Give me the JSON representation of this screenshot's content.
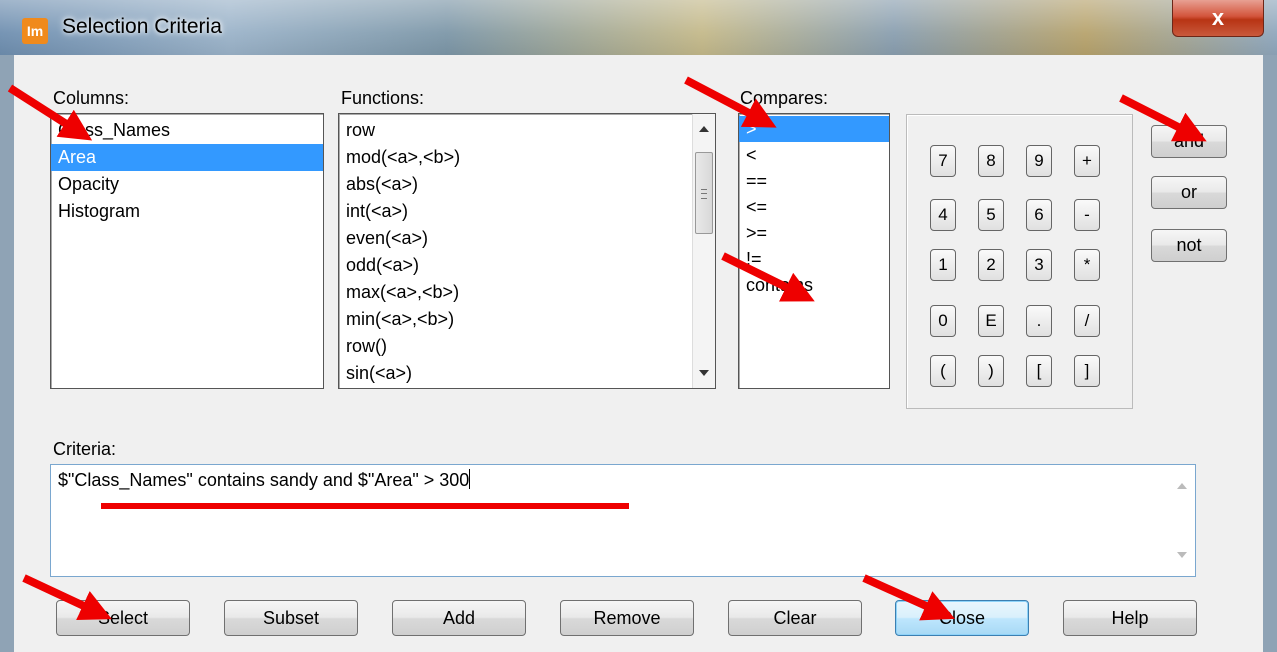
{
  "window": {
    "title": "Selection Criteria",
    "app_icon": "Im",
    "close_glyph": "x"
  },
  "columns": {
    "label": "Columns:",
    "items": [
      "Class_Names",
      "Area",
      "Opacity",
      "Histogram"
    ],
    "selected": "Area"
  },
  "functions": {
    "label": "Functions:",
    "items": [
      "row",
      "mod(<a>,<b>)",
      "abs(<a>)",
      "int(<a>)",
      "even(<a>)",
      "odd(<a>)",
      "max(<a>,<b>)",
      "min(<a>,<b>)",
      "row()",
      "sin(<a>)"
    ]
  },
  "compares": {
    "label": "Compares:",
    "items": [
      ">",
      "<",
      "==",
      "<=",
      ">=",
      "!=",
      "contains"
    ],
    "selected": ">"
  },
  "keypad": {
    "rows": [
      [
        "7",
        "8",
        "9",
        "+"
      ],
      [
        "4",
        "5",
        "6",
        "-"
      ],
      [
        "1",
        "2",
        "3",
        "*"
      ],
      [
        "0",
        "E",
        ".",
        "/"
      ],
      [
        "(",
        ")",
        "[",
        "]"
      ]
    ]
  },
  "logic_buttons": {
    "and": "and",
    "or": "or",
    "not": "not"
  },
  "criteria": {
    "label": "Criteria:",
    "value": "$\"Class_Names\" contains sandy and $\"Area\" > 300"
  },
  "bottom_buttons": {
    "select": "Select",
    "subset": "Subset",
    "add": "Add",
    "remove": "Remove",
    "clear": "Clear",
    "close": "Close",
    "help": "Help"
  },
  "annotation_color": "#ee0000"
}
